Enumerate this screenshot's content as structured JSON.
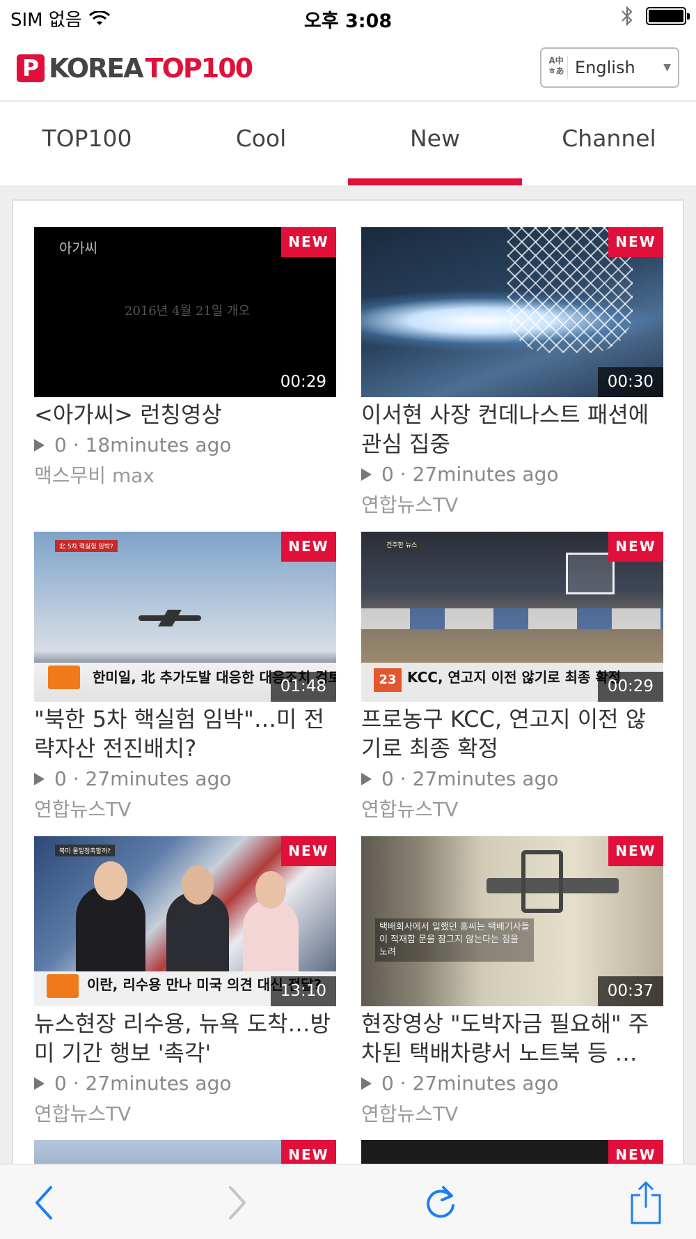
{
  "status_bar": {
    "carrier": "SIM 없음",
    "time": "오후 3:08",
    "battery_level_percent": 100
  },
  "header": {
    "logo_badge": "P",
    "logo_text_a": "KOREA",
    "logo_text_b": "TOP100",
    "language": {
      "selected": "English",
      "icon": "translate-icon"
    }
  },
  "tabs": [
    {
      "label": "TOP100",
      "active": false
    },
    {
      "label": "Cool",
      "active": false
    },
    {
      "label": "New",
      "active": true
    },
    {
      "label": "Channel",
      "active": false
    }
  ],
  "videos": [
    {
      "badge": "NEW",
      "duration": "00:29",
      "title": "<아가씨> 런칭영상",
      "views": "0",
      "time_ago": "· 18minutes ago",
      "channel": "맥스무비 max",
      "thumb_text": [
        "아가씨",
        "2016년 4월 21일 개오"
      ]
    },
    {
      "badge": "NEW",
      "duration": "00:30",
      "title": "이서현 사장 컨데나스트 패션에 관심 집중",
      "views": "0",
      "time_ago": "· 27minutes ago",
      "channel": "연합뉴스TV"
    },
    {
      "badge": "NEW",
      "duration": "01:48",
      "title": "\"북한 5차 핵실험 임박\"…미 전략자산 전진배치?",
      "views": "0",
      "time_ago": "· 27minutes ago",
      "channel": "연합뉴스TV",
      "thumb_text": [
        "北 5차 핵실험 임박?",
        "한미일, 北 추가도발 대응한 대응조치 검토"
      ]
    },
    {
      "badge": "NEW",
      "duration": "00:29",
      "title": "프로농구 KCC, 연고지 이전 않기로 최종 확정",
      "views": "0",
      "time_ago": "· 27minutes ago",
      "channel": "연합뉴스TV",
      "thumb_text": [
        "건주한 뉴스",
        "23",
        "KCC, 연고지 이전 않기로 최종 확정"
      ]
    },
    {
      "badge": "NEW",
      "duration": "13:10",
      "title": "뉴스현장 리수용, 뉴욕 도착…방미 기간 행보 '촉각'",
      "views": "0",
      "time_ago": "· 27minutes ago",
      "channel": "연합뉴스TV",
      "thumb_text": [
        "북미 물밑접촉할까?",
        "이란, 리수용 만나 미국 의견 대신 전달?"
      ]
    },
    {
      "badge": "NEW",
      "duration": "00:37",
      "title": "현장영상 \"도박자금 필요해\" 주차된 택배차량서 노트북 등 …",
      "views": "0",
      "time_ago": "· 27minutes ago",
      "channel": "연합뉴스TV",
      "thumb_text": [
        "택배회사에서 일했던 홍씨는 택배기사들이 적재함 문을 잠그지 않는다는 점을 노려"
      ]
    }
  ],
  "partial_row": [
    {
      "badge": "NEW"
    },
    {
      "badge": "NEW"
    }
  ],
  "toolbar": {
    "buttons": [
      "back-icon",
      "forward-icon",
      "reload-icon",
      "share-icon"
    ],
    "accent_color": "#1e7ef0",
    "disabled_color": "#c4c4c4"
  },
  "colors": {
    "brand_red": "#e0103a"
  }
}
